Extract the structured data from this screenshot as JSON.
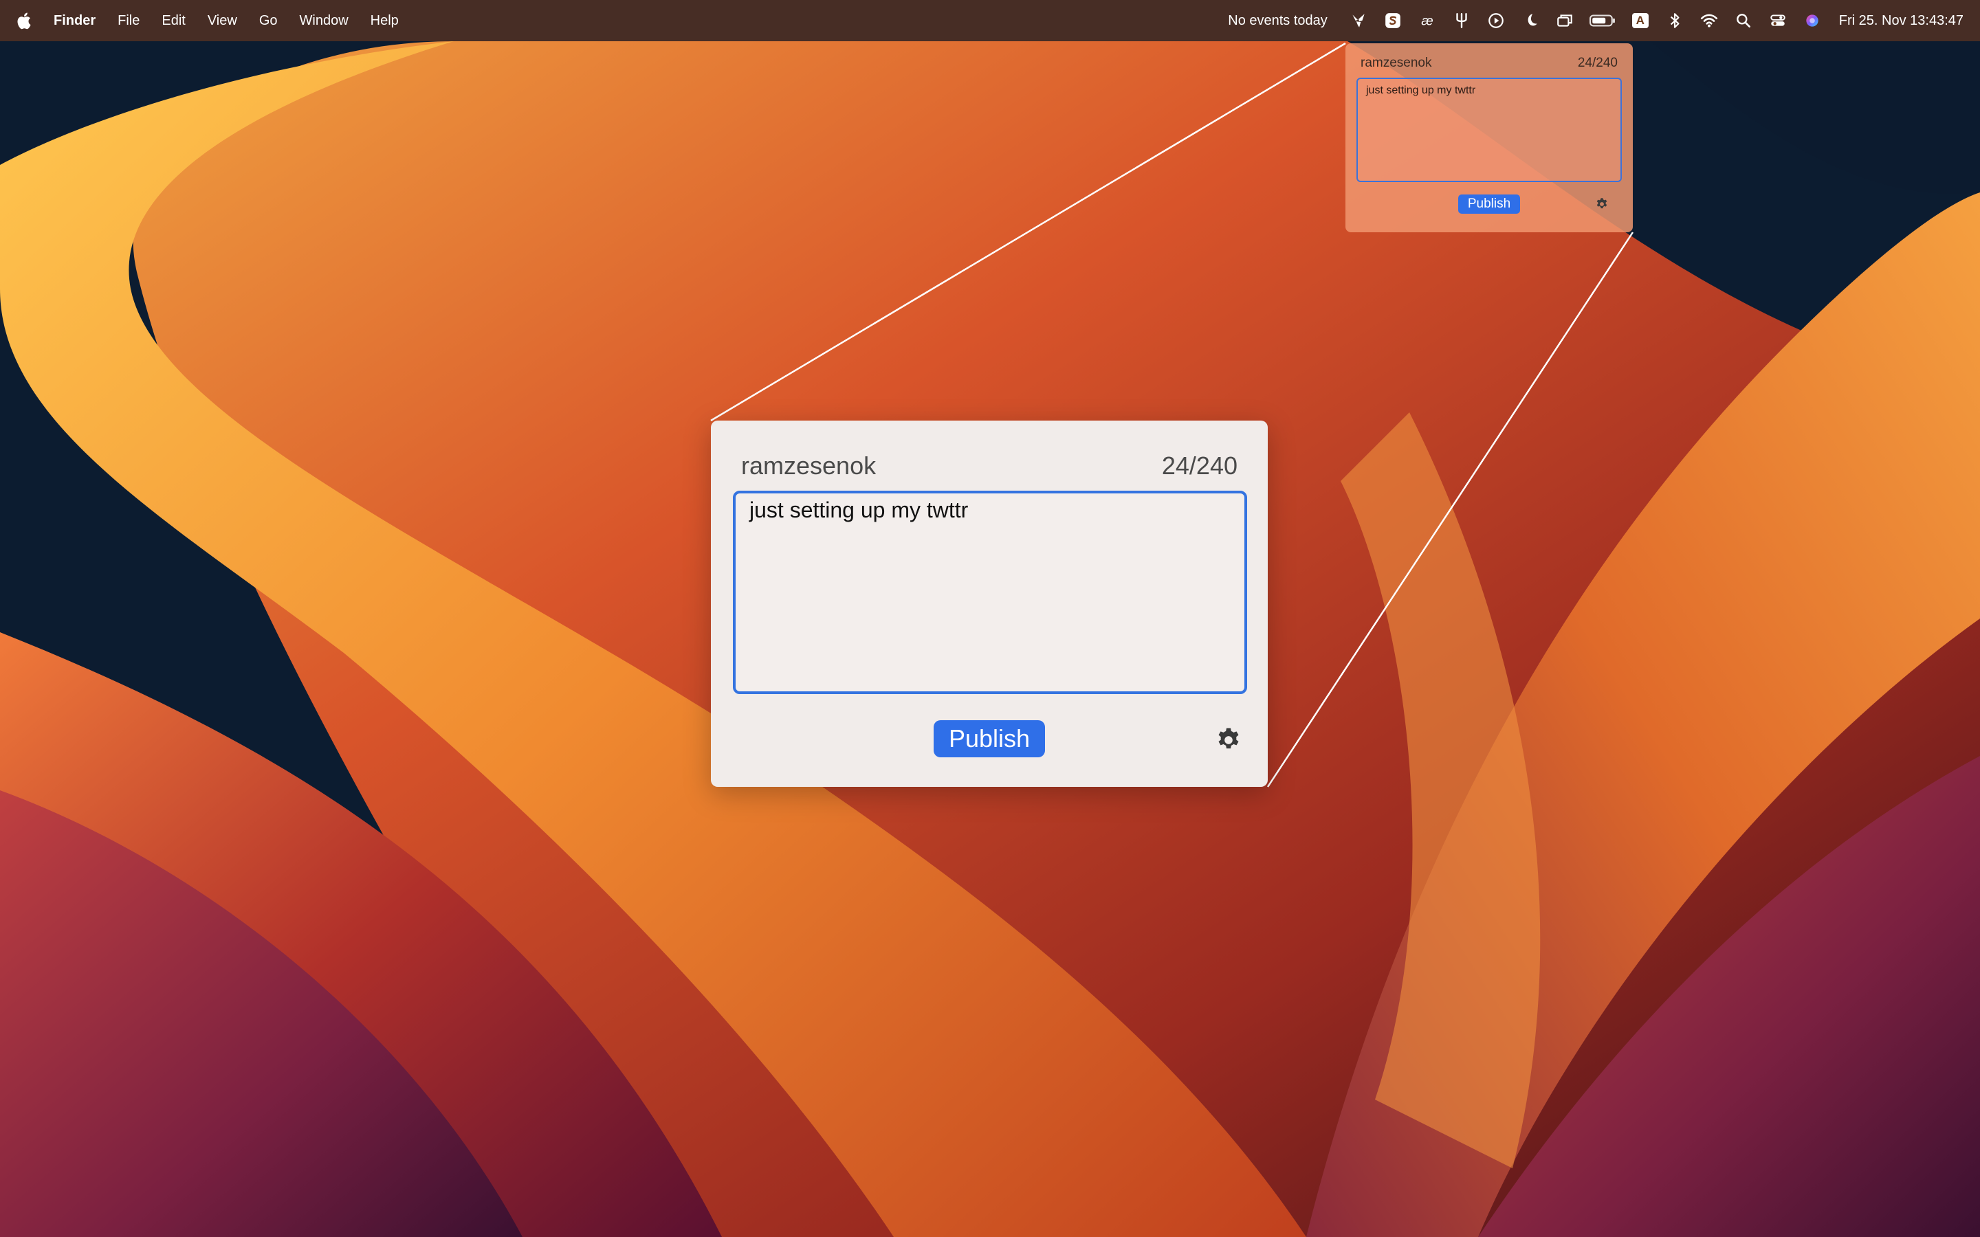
{
  "menubar": {
    "app_name": "Finder",
    "menus": [
      "File",
      "Edit",
      "View",
      "Go",
      "Window",
      "Help"
    ],
    "calendar_status": "No events today",
    "status_icons": [
      "bird-icon",
      "s-app-icon",
      "ae-ligature-icon",
      "tuning-fork-icon",
      "play-circle-icon",
      "moon-icon",
      "screen-mirroring-icon",
      "battery-icon",
      "input-source-icon",
      "bluetooth-icon",
      "wifi-icon",
      "spotlight-search-icon",
      "control-center-icon",
      "siri-icon"
    ],
    "input_source_letter": "A",
    "clock": "Fri 25. Nov  13:43:47"
  },
  "popover_small": {
    "username": "ramzesenok",
    "char_count": "24/240",
    "text": "just setting up my twttr",
    "publish_label": "Publish"
  },
  "popover_large": {
    "username": "ramzesenok",
    "char_count": "24/240",
    "text": "just setting up my twttr",
    "publish_label": "Publish"
  },
  "colors": {
    "accent": "#2f6fe8",
    "popover_background": "#f1ecea",
    "menubar_text": "#ffffff"
  }
}
